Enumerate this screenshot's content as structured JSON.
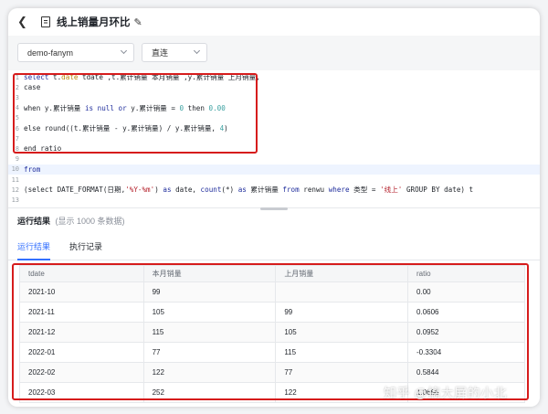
{
  "header": {
    "title": "线上销量月环比"
  },
  "toolbar": {
    "database": "demo-fanym",
    "connection": "直连"
  },
  "editor": {
    "lines": [
      {
        "num": "1",
        "parts": [
          [
            "kw",
            "select "
          ],
          [
            "",
            "t."
          ],
          [
            "fld",
            "date"
          ],
          [
            "",
            " tdate ,t.累计销量 本月销量 ,y.累计销量 上月销量,"
          ]
        ]
      },
      {
        "num": "2",
        "parts": [
          [
            "",
            "case"
          ]
        ]
      },
      {
        "num": "3",
        "parts": []
      },
      {
        "num": "4",
        "parts": [
          [
            "",
            "when y.累计销量 "
          ],
          [
            "kw",
            "is null or"
          ],
          [
            "",
            " y.累计销量 = "
          ],
          [
            "num-lit",
            "0"
          ],
          [
            "",
            " then "
          ],
          [
            "num-lit",
            "0.00"
          ]
        ]
      },
      {
        "num": "5",
        "parts": []
      },
      {
        "num": "6",
        "parts": [
          [
            "",
            "else round((t.累计销量 - y.累计销量) / y.累计销量, "
          ],
          [
            "num-lit",
            "4"
          ],
          [
            "",
            ")"
          ]
        ]
      },
      {
        "num": "7",
        "parts": []
      },
      {
        "num": "8",
        "parts": [
          [
            "",
            "end ratio"
          ]
        ]
      },
      {
        "num": "9",
        "parts": []
      },
      {
        "num": "10",
        "parts": [
          [
            "kw",
            "from"
          ]
        ]
      },
      {
        "num": "11",
        "parts": []
      },
      {
        "num": "12",
        "parts": [
          [
            "",
            "(select DATE_FORMAT(日期,"
          ],
          [
            "str",
            "'%Y-%m'"
          ],
          [
            "",
            ") "
          ],
          [
            "kw",
            "as"
          ],
          [
            "",
            " date, "
          ],
          [
            "kw",
            "count"
          ],
          [
            "",
            "(*) "
          ],
          [
            "kw",
            "as"
          ],
          [
            "",
            " 累计销量 "
          ],
          [
            "kw",
            "from"
          ],
          [
            "",
            " renwu "
          ],
          [
            "kw",
            "where"
          ],
          [
            "",
            " 类型 = "
          ],
          [
            "str",
            "'线上'"
          ],
          [
            "",
            " GROUP BY date) t"
          ]
        ]
      },
      {
        "num": "13",
        "parts": []
      }
    ]
  },
  "results": {
    "title": "运行结果",
    "subtitle": "(显示 1000 条数据)",
    "tabs": [
      "运行结果",
      "执行记录"
    ],
    "columns": [
      "tdate",
      "本月销量",
      "上月销量",
      "ratio"
    ],
    "rows": [
      [
        "2021-10",
        "99",
        "",
        "0.00"
      ],
      [
        "2021-11",
        "105",
        "99",
        "0.0606"
      ],
      [
        "2021-12",
        "115",
        "105",
        "0.0952"
      ],
      [
        "2022-01",
        "77",
        "115",
        "-0.3304"
      ],
      [
        "2022-02",
        "122",
        "77",
        "0.5844"
      ],
      [
        "2022-03",
        "252",
        "122",
        "1.0656"
      ]
    ]
  },
  "watermark": "知乎 @搞大屏的小北",
  "colors": {
    "accent": "#3370ff",
    "highlight": "#d61c1c"
  }
}
